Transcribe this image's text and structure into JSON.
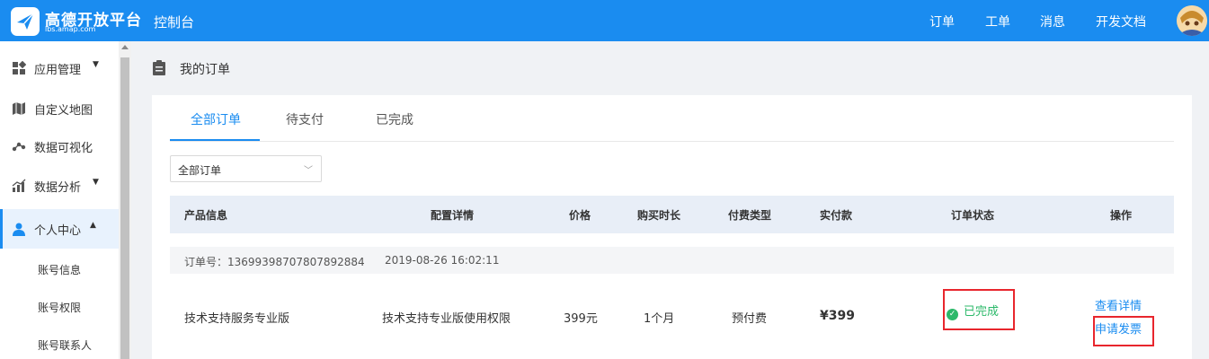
{
  "header": {
    "logo_name": "高德开放平台",
    "logo_sub": "lbs.amap.com",
    "console": "控制台",
    "nav": [
      "订单",
      "工单",
      "消息",
      "开发文档"
    ],
    "accent": "#1a8cf0"
  },
  "sidebar": {
    "items": [
      {
        "label": "应用管理",
        "icon": "apps-icon",
        "arrow": "▼"
      },
      {
        "label": "自定义地图",
        "icon": "map-icon"
      },
      {
        "label": "数据可视化",
        "icon": "visualization-icon"
      },
      {
        "label": "数据分析",
        "icon": "analytics-icon",
        "arrow": "▼"
      },
      {
        "label": "个人中心",
        "icon": "user-icon",
        "arrow": "▲"
      }
    ],
    "subitems": [
      "账号信息",
      "账号权限",
      "账号联系人"
    ]
  },
  "page": {
    "title": "我的订单"
  },
  "tabs": [
    "全部订单",
    "待支付",
    "已完成"
  ],
  "filter": {
    "selected": "全部订单"
  },
  "table": {
    "columns": [
      "产品信息",
      "配置详情",
      "价格",
      "购买时长",
      "付费类型",
      "实付款",
      "订单状态",
      "操作"
    ],
    "order": {
      "order_no": "订单号：13699398707807892884",
      "time": "2019-08-26 16:02:11",
      "product": "技术支持服务专业版",
      "config": "技术支持专业版使用权限",
      "price": "399元",
      "duration": "1个月",
      "pay_type": "预付费",
      "paid": "¥399",
      "status": "已完成",
      "status_color": "#2cb96a",
      "actions": [
        "查看详情",
        "申请发票"
      ]
    }
  }
}
